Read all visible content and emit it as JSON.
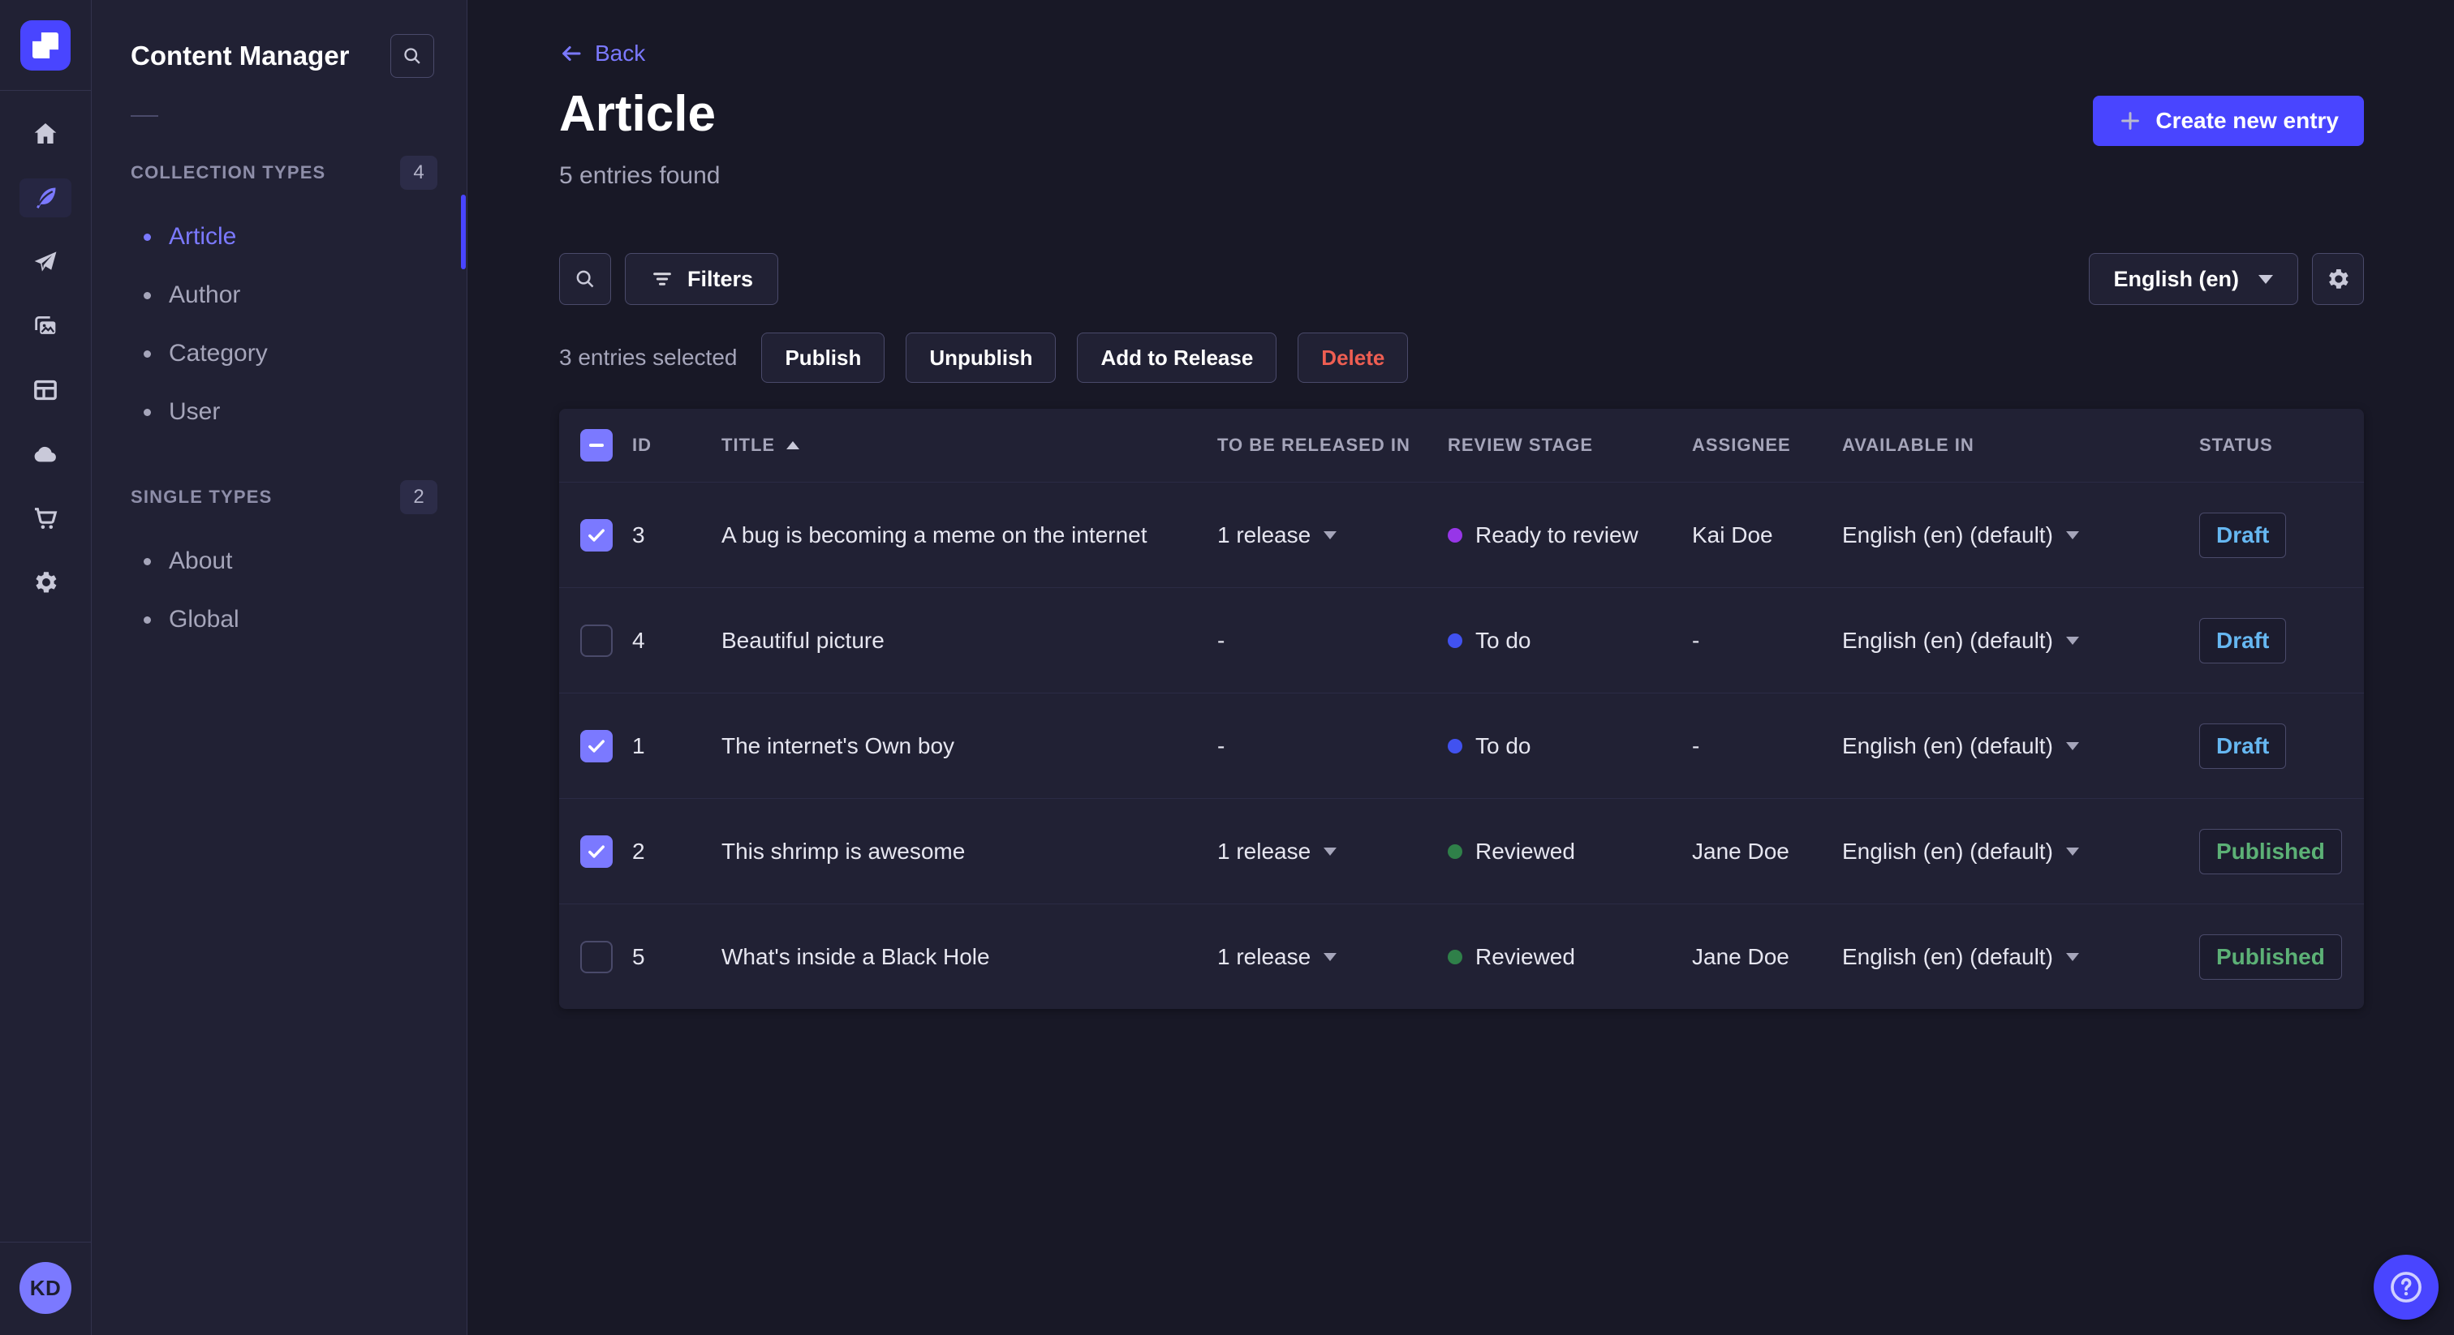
{
  "colors": {
    "accent": "#4945ff",
    "link": "#7b79ff",
    "danger": "#ee5e52",
    "status": {
      "draft": "#66b7f1",
      "published": "#5cb176"
    }
  },
  "nav_rail": {
    "icons": [
      "home-icon",
      "content-manager-feather-icon",
      "paper-plane-icon",
      "media-library-images-icon",
      "layout-card-icon",
      "cloud-icon",
      "shopping-cart-icon",
      "gear-icon"
    ],
    "active_icon": "content-manager-feather-icon",
    "avatar_initials": "KD"
  },
  "sidebar": {
    "title": "Content Manager",
    "sections": [
      {
        "label": "COLLECTION TYPES",
        "count": "4",
        "items": [
          {
            "label": "Article",
            "active": true
          },
          {
            "label": "Author",
            "active": false
          },
          {
            "label": "Category",
            "active": false
          },
          {
            "label": "User",
            "active": false
          }
        ]
      },
      {
        "label": "SINGLE TYPES",
        "count": "2",
        "items": [
          {
            "label": "About",
            "active": false
          },
          {
            "label": "Global",
            "active": false
          }
        ]
      }
    ]
  },
  "header": {
    "back_label": "Back",
    "title": "Article",
    "subtitle": "5 entries found",
    "create_button_label": "Create new entry"
  },
  "toolbar": {
    "filters_label": "Filters",
    "locale_value": "English (en)"
  },
  "selection": {
    "text": "3 entries selected",
    "publish_label": "Publish",
    "unpublish_label": "Unpublish",
    "add_to_release_label": "Add to Release",
    "delete_label": "Delete"
  },
  "table": {
    "columns": [
      "ID",
      "TITLE",
      "TO BE RELEASED IN",
      "REVIEW STAGE",
      "ASSIGNEE",
      "AVAILABLE IN",
      "STATUS"
    ],
    "sort": {
      "column": "TITLE",
      "direction": "asc"
    },
    "rows": [
      {
        "checked": true,
        "id": "3",
        "title": "A bug is becoming a meme on the internet",
        "release": "1 release",
        "stage": "Ready to review",
        "stage_color": "#9736e8",
        "assignee": "Kai Doe",
        "locale": "English (en) (default)",
        "status": "Draft"
      },
      {
        "checked": false,
        "id": "4",
        "title": "Beautiful picture",
        "release": "-",
        "stage": "To do",
        "stage_color": "#4152f0",
        "assignee": "-",
        "locale": "English (en) (default)",
        "status": "Draft"
      },
      {
        "checked": true,
        "id": "1",
        "title": "The internet's Own boy",
        "release": "-",
        "stage": "To do",
        "stage_color": "#4152f0",
        "assignee": "-",
        "locale": "English (en) (default)",
        "status": "Draft"
      },
      {
        "checked": true,
        "id": "2",
        "title": "This shrimp is awesome",
        "release": "1 release",
        "stage": "Reviewed",
        "stage_color": "#2f8049",
        "assignee": "Jane Doe",
        "locale": "English (en) (default)",
        "status": "Published"
      },
      {
        "checked": false,
        "id": "5",
        "title": "What's inside a Black Hole",
        "release": "1 release",
        "stage": "Reviewed",
        "stage_color": "#2f8049",
        "assignee": "Jane Doe",
        "locale": "English (en) (default)",
        "status": "Published"
      }
    ]
  },
  "help": {
    "tooltip": "Help"
  }
}
